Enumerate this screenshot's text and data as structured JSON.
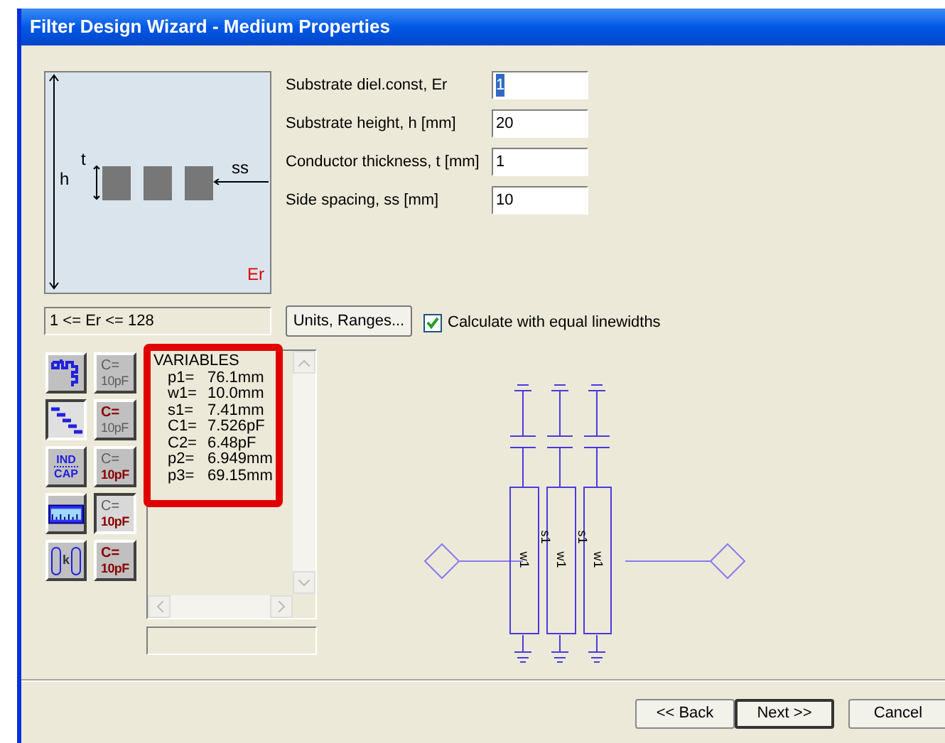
{
  "window": {
    "title": "Filter Design Wizard - Medium Properties"
  },
  "diagram": {
    "height_label": "h",
    "thickness_label": "t",
    "spacing_label": "ss",
    "er_label": "Er"
  },
  "fields": [
    {
      "label": "Substrate diel.const, Er",
      "value": "1",
      "selected": true
    },
    {
      "label": "Substrate height, h [mm]",
      "value": "20",
      "selected": false
    },
    {
      "label": "Conductor thickness, t [mm]",
      "value": "1",
      "selected": false
    },
    {
      "label": "Side spacing, ss [mm]",
      "value": "10",
      "selected": false
    }
  ],
  "range_hint": "1 <= Er <= 128",
  "units_button": "Units, Ranges...",
  "equal_linewidths": {
    "label": "Calculate with equal linewidths",
    "checked": true
  },
  "topology_tools": [
    {
      "kind": "meander",
      "selected": false
    },
    {
      "kind": "stepped",
      "selected": true
    },
    {
      "kind": "indcap",
      "top": "IND",
      "bottom": "CAP",
      "selected": false
    },
    {
      "kind": "ruler",
      "selected": false
    },
    {
      "kind": "coupled",
      "text": "k",
      "selected": false
    }
  ],
  "capacitor_tools": [
    {
      "top": "C=",
      "bottom": "10pF",
      "top_active": false,
      "bottom_active": false,
      "selected": false
    },
    {
      "top": "C=",
      "bottom": "10pF",
      "top_active": true,
      "bottom_active": false,
      "selected": false
    },
    {
      "top": "C=",
      "bottom": "10pF",
      "top_active": false,
      "bottom_active": true,
      "selected": false
    },
    {
      "top": "C=",
      "bottom": "10pF",
      "top_active": false,
      "bottom_active": true,
      "selected": true
    },
    {
      "top": "C=",
      "bottom": "10pF",
      "top_active": true,
      "bottom_active": true,
      "selected": false
    }
  ],
  "variables": {
    "heading": "VARIABLES",
    "rows": [
      {
        "name": "p1=",
        "value": "76.1mm"
      },
      {
        "name": "w1=",
        "value": "10.0mm"
      },
      {
        "name": "s1=",
        "value": "7.41mm"
      },
      {
        "name": "C1=",
        "value": "7.526pF"
      },
      {
        "name": "C2=",
        "value": "6.48pF"
      },
      {
        "name": "p2=",
        "value": "6.949mm"
      },
      {
        "name": "p3=",
        "value": "69.15mm"
      }
    ]
  },
  "schematic": {
    "line_labels": [
      "w1",
      "w1",
      "w1"
    ],
    "gap_labels": [
      "s1",
      "s1"
    ]
  },
  "buttons": [
    {
      "label": "<< Back",
      "selected": false
    },
    {
      "label": "Next >>",
      "selected": true
    },
    {
      "label": "Cancel",
      "selected": false
    }
  ]
}
